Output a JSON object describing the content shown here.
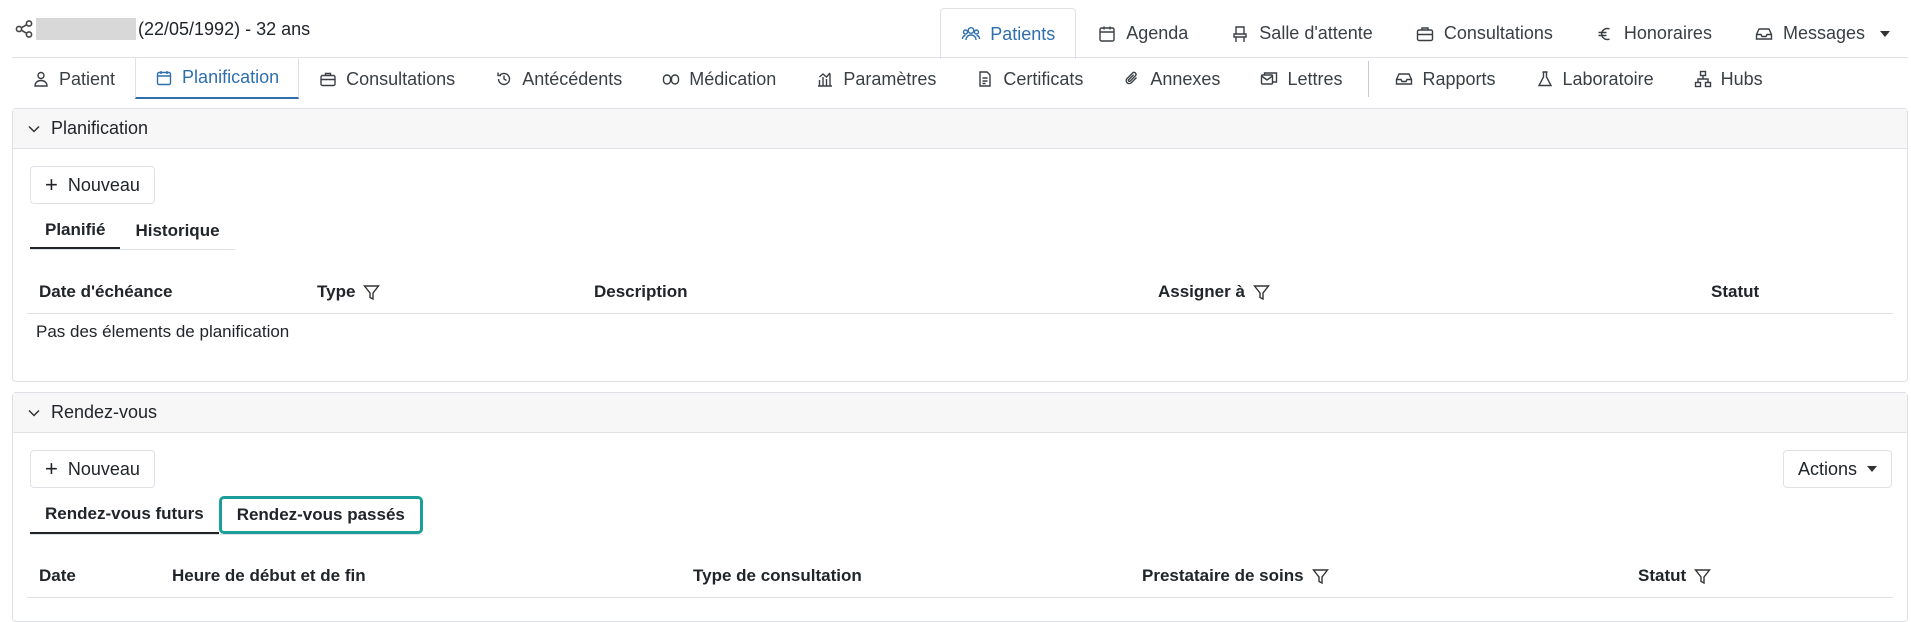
{
  "patient": {
    "meta": "(22/05/1992) - 32 ans"
  },
  "top_nav": [
    {
      "label": "Patients",
      "icon": "users-icon",
      "active": true
    },
    {
      "label": "Agenda",
      "icon": "calendar-icon"
    },
    {
      "label": "Salle d'attente",
      "icon": "chair-icon"
    },
    {
      "label": "Consultations",
      "icon": "briefcase-icon"
    },
    {
      "label": "Honoraires",
      "icon": "euro-icon"
    },
    {
      "label": "Messages",
      "icon": "inbox-icon",
      "dropdown": true
    }
  ],
  "sub_nav": [
    {
      "label": "Patient",
      "icon": "person-icon"
    },
    {
      "label": "Planification",
      "icon": "calendar-icon",
      "active": true
    },
    {
      "label": "Consultations",
      "icon": "briefcase-icon"
    },
    {
      "label": "Antécédents",
      "icon": "history-icon"
    },
    {
      "label": "Médication",
      "icon": "pill-icon"
    },
    {
      "label": "Paramètres",
      "icon": "chart-icon"
    },
    {
      "label": "Certificats",
      "icon": "document-icon"
    },
    {
      "label": "Annexes",
      "icon": "paperclip-icon"
    },
    {
      "label": "Lettres",
      "icon": "letters-icon"
    },
    {
      "label": "Rapports",
      "icon": "inbox-icon"
    },
    {
      "label": "Laboratoire",
      "icon": "flask-icon"
    },
    {
      "label": "Hubs",
      "icon": "network-icon"
    }
  ],
  "planification": {
    "title": "Planification",
    "new_label": "Nouveau",
    "tabs": [
      "Planifié",
      "Historique"
    ],
    "columns": [
      "Date d'échéance",
      "Type",
      "Description",
      "Assigner à",
      "Statut"
    ],
    "empty_message": "Pas des élements de planification"
  },
  "rendezvous": {
    "title": "Rendez-vous",
    "new_label": "Nouveau",
    "actions_label": "Actions",
    "tabs": [
      "Rendez-vous futurs",
      "Rendez-vous passés"
    ],
    "columns": [
      "Date",
      "Heure de début et de fin",
      "Type de consultation",
      "Prestataire de soins",
      "Statut"
    ]
  },
  "colors": {
    "accent": "#2f6fae",
    "focus": "#1b9e97"
  }
}
